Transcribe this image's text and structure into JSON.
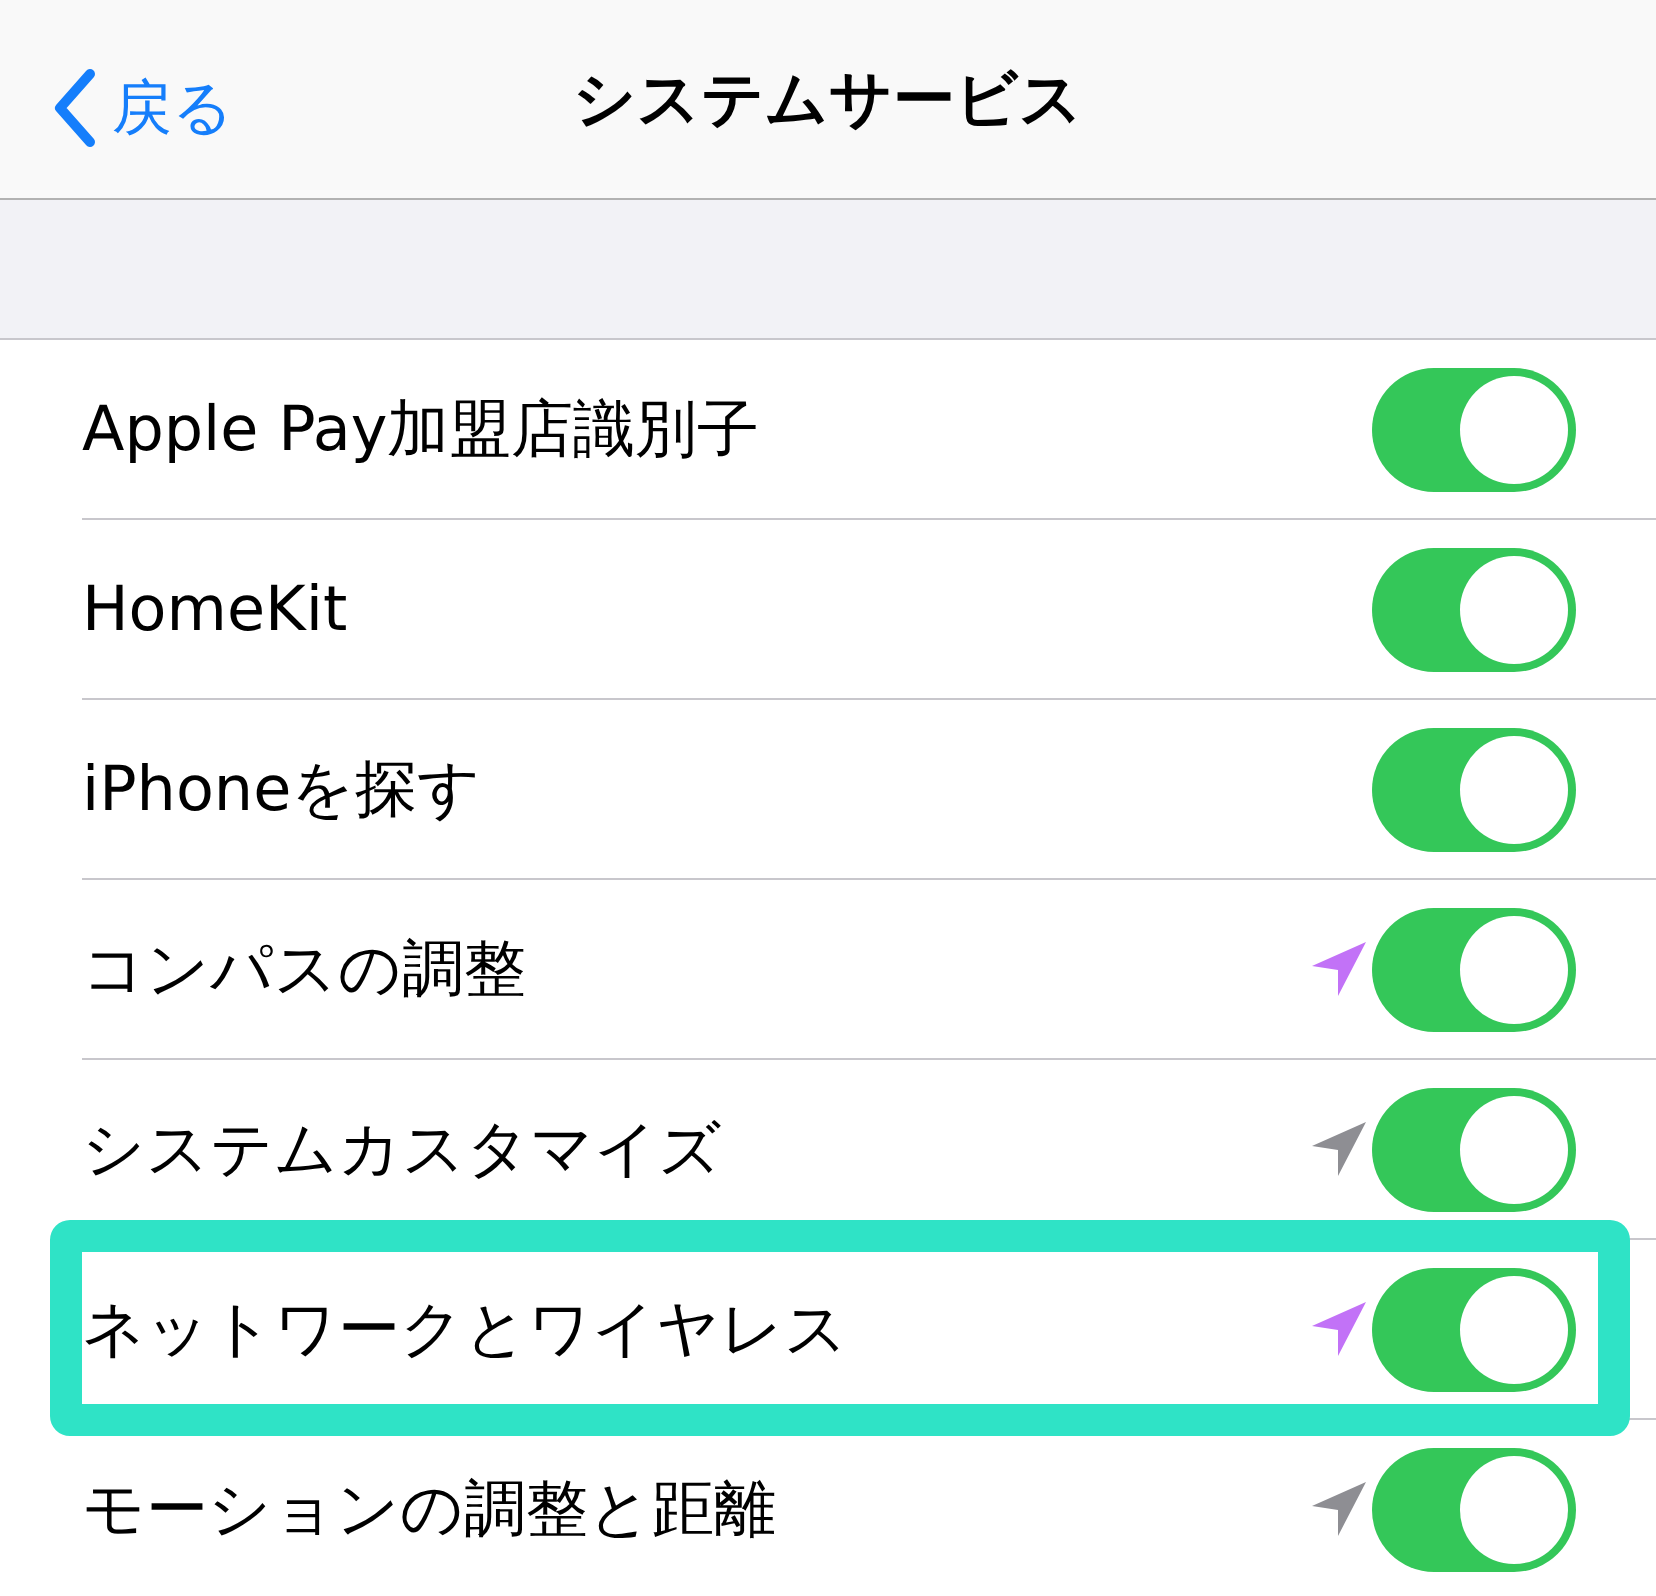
{
  "nav_bar": {
    "back_button": {
      "label": "戻る"
    },
    "title": "システムサービス"
  },
  "rows": [
    {
      "label": "Apple Pay加盟店識別子",
      "on": true,
      "highlighted": false
    },
    {
      "label": "HomeKit",
      "on": true,
      "highlighted": false
    },
    {
      "label": "iPhoneを探す",
      "on": true,
      "highlighted": false
    },
    {
      "label": "コンパスの調整",
      "on": true,
      "highlighted": false,
      "arrow": {
        "color": "#c272f7"
      }
    },
    {
      "label": "システムカスタマイズ",
      "on": true,
      "highlighted": false,
      "arrow": {
        "color": "#8e8e93"
      }
    },
    {
      "label": "ネットワークとワイヤレス",
      "on": true,
      "highlighted": true,
      "arrow": {
        "color": "#c272f7"
      }
    },
    {
      "label": "モーションの調整と距離",
      "on": true,
      "highlighted": false,
      "arrow": {
        "color": "#8e8e93"
      }
    }
  ]
}
